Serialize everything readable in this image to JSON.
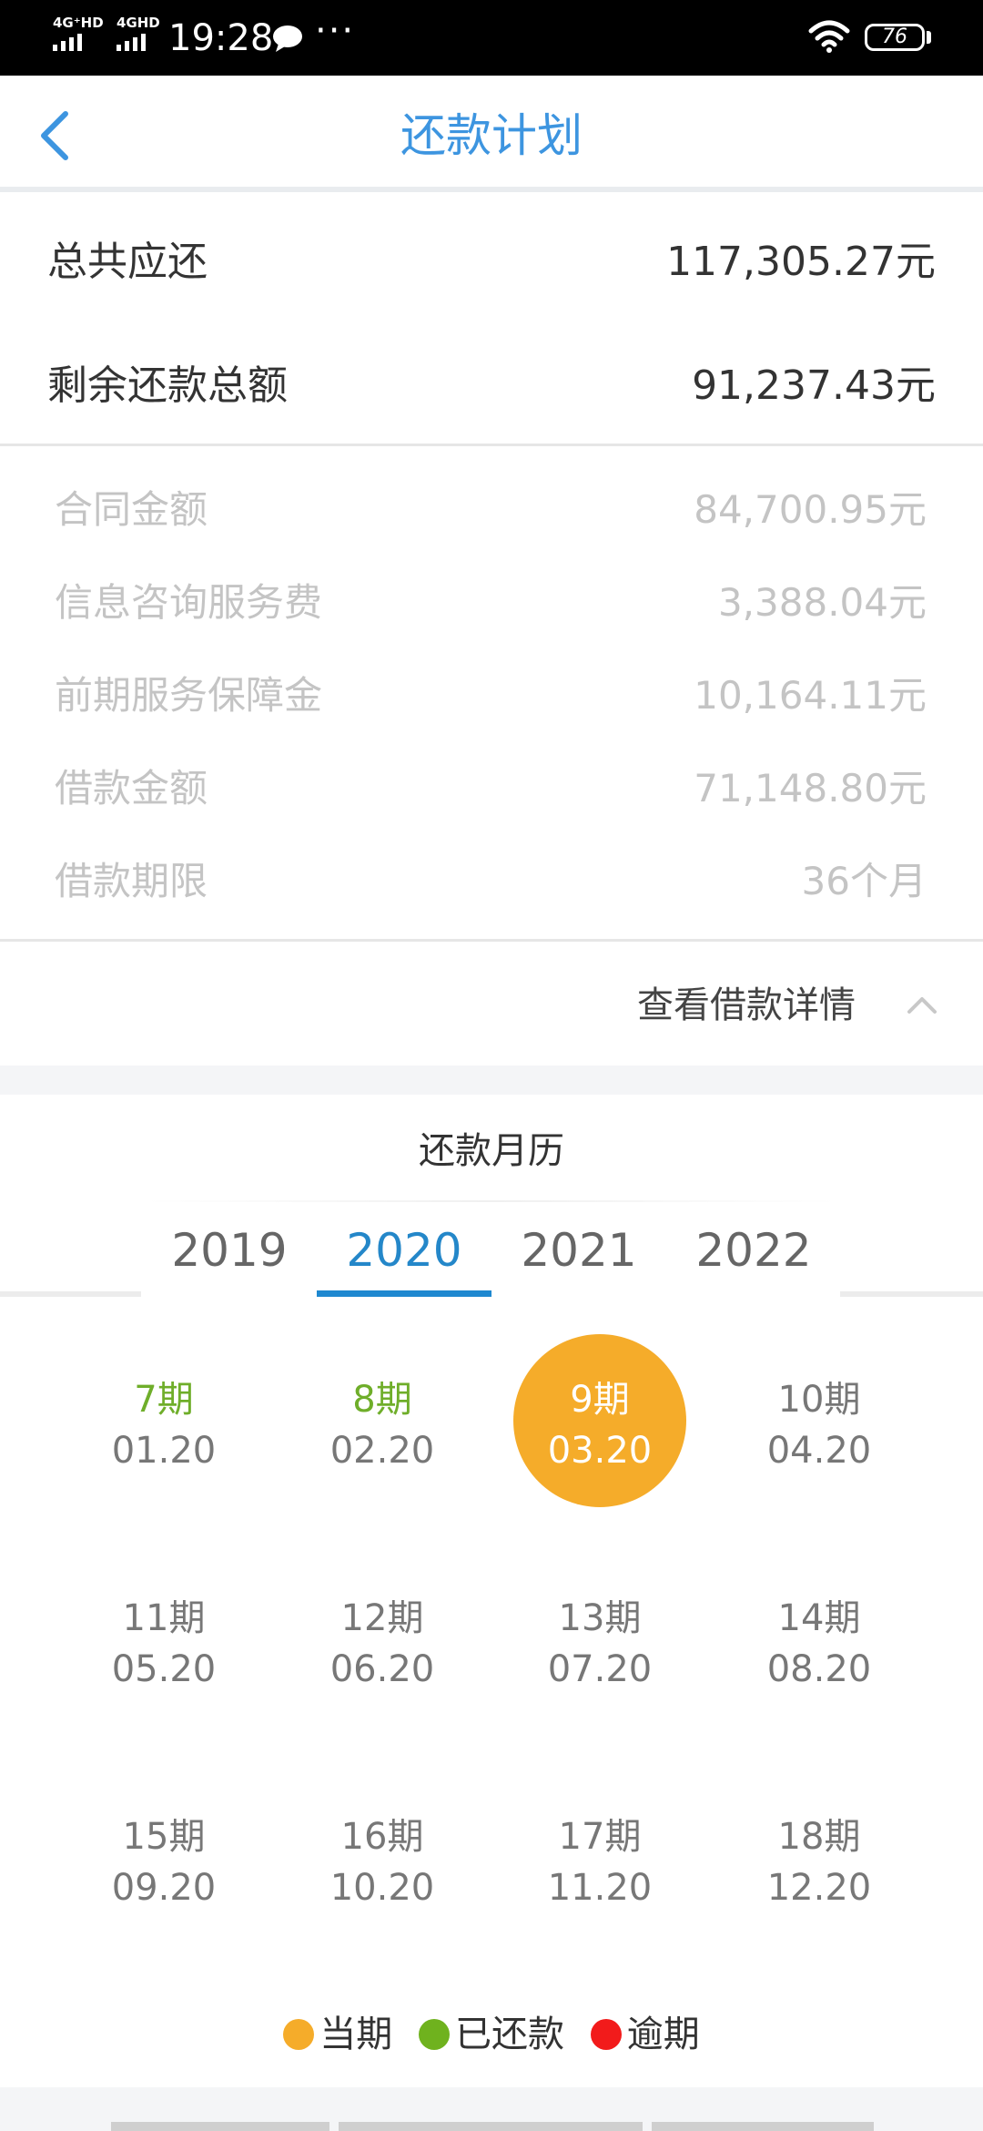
{
  "status_bar": {
    "network1": "4G⁺HD",
    "network2": "4GHD",
    "time": "19:28",
    "more": "···",
    "battery": "76"
  },
  "header": {
    "title": "还款计划",
    "back_icon": "chevron-left-icon"
  },
  "summary": {
    "total_label": "总共应还",
    "total_value": "117,305.27元",
    "remaining_label": "剩余还款总额",
    "remaining_value": "91,237.43元"
  },
  "details": [
    {
      "label": "合同金额",
      "value": "84,700.95元"
    },
    {
      "label": "信息咨询服务费",
      "value": "3,388.04元"
    },
    {
      "label": "前期服务保障金",
      "value": "10,164.11元"
    },
    {
      "label": "借款金额",
      "value": "71,148.80元"
    },
    {
      "label": "借款期限",
      "value": "36个月"
    }
  ],
  "toggle": {
    "label": "查看借款详情",
    "icon": "chevron-up-icon"
  },
  "calendar": {
    "title": "还款月历",
    "years": [
      "2019",
      "2020",
      "2021",
      "2022"
    ],
    "selected_year": "2020",
    "periods": [
      {
        "period": "7期",
        "date": "01.20",
        "status": "paid"
      },
      {
        "period": "8期",
        "date": "02.20",
        "status": "paid"
      },
      {
        "period": "9期",
        "date": "03.20",
        "status": "current"
      },
      {
        "period": "10期",
        "date": "04.20",
        "status": "upcoming"
      },
      {
        "period": "11期",
        "date": "05.20",
        "status": "upcoming"
      },
      {
        "period": "12期",
        "date": "06.20",
        "status": "upcoming"
      },
      {
        "period": "13期",
        "date": "07.20",
        "status": "upcoming"
      },
      {
        "period": "14期",
        "date": "08.20",
        "status": "upcoming"
      },
      {
        "period": "15期",
        "date": "09.20",
        "status": "upcoming"
      },
      {
        "period": "16期",
        "date": "10.20",
        "status": "upcoming"
      },
      {
        "period": "17期",
        "date": "11.20",
        "status": "upcoming"
      },
      {
        "period": "18期",
        "date": "12.20",
        "status": "upcoming"
      }
    ]
  },
  "legend": [
    {
      "label": "当期",
      "color": "#f5ac2a"
    },
    {
      "label": "已还款",
      "color": "#6fb21e"
    },
    {
      "label": "逾期",
      "color": "#f21b1b"
    }
  ],
  "colors": {
    "accent": "#3d95e0",
    "tab_active": "#1e88d0",
    "paid": "#6fae2a",
    "current": "#f5ac2a"
  }
}
